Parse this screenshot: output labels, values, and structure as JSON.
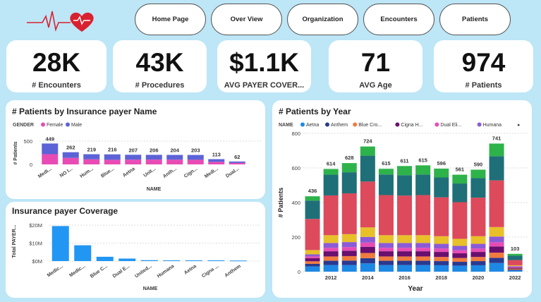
{
  "nav": {
    "items": [
      "Home Page",
      "Over View",
      "Organization",
      "Encounters",
      "Patients"
    ]
  },
  "kpis": [
    {
      "value": "28K",
      "label": "# Encounters"
    },
    {
      "value": "43K",
      "label": "# Procedures"
    },
    {
      "value": "$1.1K",
      "label": "AVG PAYER COVER..."
    },
    {
      "value": "71",
      "label": "AVG Age"
    },
    {
      "value": "974",
      "label": "# Patients"
    }
  ],
  "colors": {
    "page_bg": "#bde6f7",
    "female": "#e84cb4",
    "male": "#5c63d6",
    "coverage": "#2196f3",
    "logo": "#d9212f"
  },
  "chart_data": [
    {
      "type": "bar",
      "title": "# Patients by Insurance payer Name",
      "legend_title": "GENDER",
      "xlabel": "NAME",
      "ylabel": "# Patients",
      "ticks": [
        "500",
        "0"
      ],
      "ylim": [
        0,
        500
      ],
      "categories": [
        "Medi...",
        "NO I...",
        "Hum...",
        "Blue...",
        "Aetna",
        "Unit...",
        "Anth...",
        "Cign...",
        "Medi...",
        "Dual..."
      ],
      "totals": [
        "449",
        "262",
        "219",
        "216",
        "207",
        "206",
        "204",
        "203",
        "113",
        "62"
      ],
      "series": [
        {
          "name": "Female",
          "values": [
            220,
            140,
            110,
            100,
            103,
            104,
            102,
            100,
            55,
            32
          ]
        },
        {
          "name": "Male",
          "values": [
            229,
            122,
            109,
            116,
            104,
            102,
            102,
            103,
            58,
            30
          ]
        }
      ]
    },
    {
      "type": "bar",
      "title": "Insurance payer Coverage",
      "xlabel": "NAME",
      "ylabel": "Total PAYER...",
      "ticks": [
        "$20M",
        "$10M",
        "$0M"
      ],
      "ylim": [
        0,
        22
      ],
      "categories": [
        "Medic...",
        "Medic...",
        "Blue C...",
        "Dual E...",
        "United...",
        "Humana",
        "Aetna",
        "Cigna ...",
        "Anthem"
      ],
      "values": [
        19.5,
        8.8,
        2.4,
        1.4,
        0.5,
        0.4,
        0.4,
        0.4,
        0.3
      ]
    },
    {
      "type": "bar",
      "title": "# Patients by Year",
      "legend_title": "NAME",
      "xlabel": "Year",
      "ylabel": "# Patients",
      "ticks": [
        "800",
        "600",
        "400",
        "200",
        "0"
      ],
      "xticks": [
        "2012",
        "2014",
        "2016",
        "2018",
        "2020",
        "2022"
      ],
      "ylim": [
        0,
        800
      ],
      "x": [
        2011,
        2012,
        2013,
        2014,
        2015,
        2016,
        2017,
        2018,
        2019,
        2020,
        2021,
        2022
      ],
      "totals": [
        "436",
        "614",
        "628",
        "724",
        "615",
        "611",
        "615",
        "596",
        "561",
        "590",
        "741",
        "103"
      ],
      "legend": [
        "Aetna",
        "Anthem",
        "Blue Cro...",
        "Cigna H...",
        "Dual Eli...",
        "Humana"
      ],
      "series": [
        {
          "name": "Aetna",
          "color": "#1e88e5",
          "values": [
            30,
            38,
            38,
            48,
            38,
            38,
            38,
            37,
            35,
            37,
            50,
            7
          ]
        },
        {
          "name": "Anthem",
          "color": "#2a3990",
          "values": [
            15,
            25,
            26,
            30,
            25,
            25,
            25,
            24,
            22,
            24,
            30,
            5
          ]
        },
        {
          "name": "Blue Cro...",
          "color": "#f07b3f",
          "values": [
            15,
            25,
            26,
            30,
            25,
            25,
            25,
            24,
            22,
            24,
            30,
            5
          ]
        },
        {
          "name": "Cigna H...",
          "color": "#6a0f6e",
          "values": [
            18,
            30,
            31,
            36,
            30,
            30,
            30,
            29,
            27,
            29,
            36,
            6
          ]
        },
        {
          "name": "Dual Eli...",
          "color": "#e84cb4",
          "values": [
            10,
            20,
            21,
            24,
            20,
            20,
            20,
            20,
            18,
            20,
            24,
            4
          ]
        },
        {
          "name": "Humana",
          "color": "#8b5bd6",
          "values": [
            12,
            28,
            29,
            33,
            28,
            28,
            28,
            27,
            25,
            27,
            33,
            5
          ]
        },
        {
          "name": "",
          "color": "#e8c02a",
          "values": [
            25,
            45,
            46,
            55,
            45,
            45,
            45,
            44,
            41,
            44,
            55,
            5
          ]
        },
        {
          "name": "",
          "color": "#dc4a5c",
          "values": [
            180,
            230,
            236,
            265,
            232,
            229,
            232,
            225,
            212,
            223,
            270,
            30
          ]
        },
        {
          "name": "",
          "color": "#1f6f78",
          "values": [
            106,
            120,
            122,
            150,
            119,
            118,
            119,
            115,
            108,
            113,
            140,
            25
          ]
        },
        {
          "name": "",
          "color": "#2db34a",
          "values": [
            25,
            33,
            53,
            53,
            33,
            53,
            53,
            51,
            51,
            49,
            73,
            11
          ]
        }
      ]
    }
  ]
}
